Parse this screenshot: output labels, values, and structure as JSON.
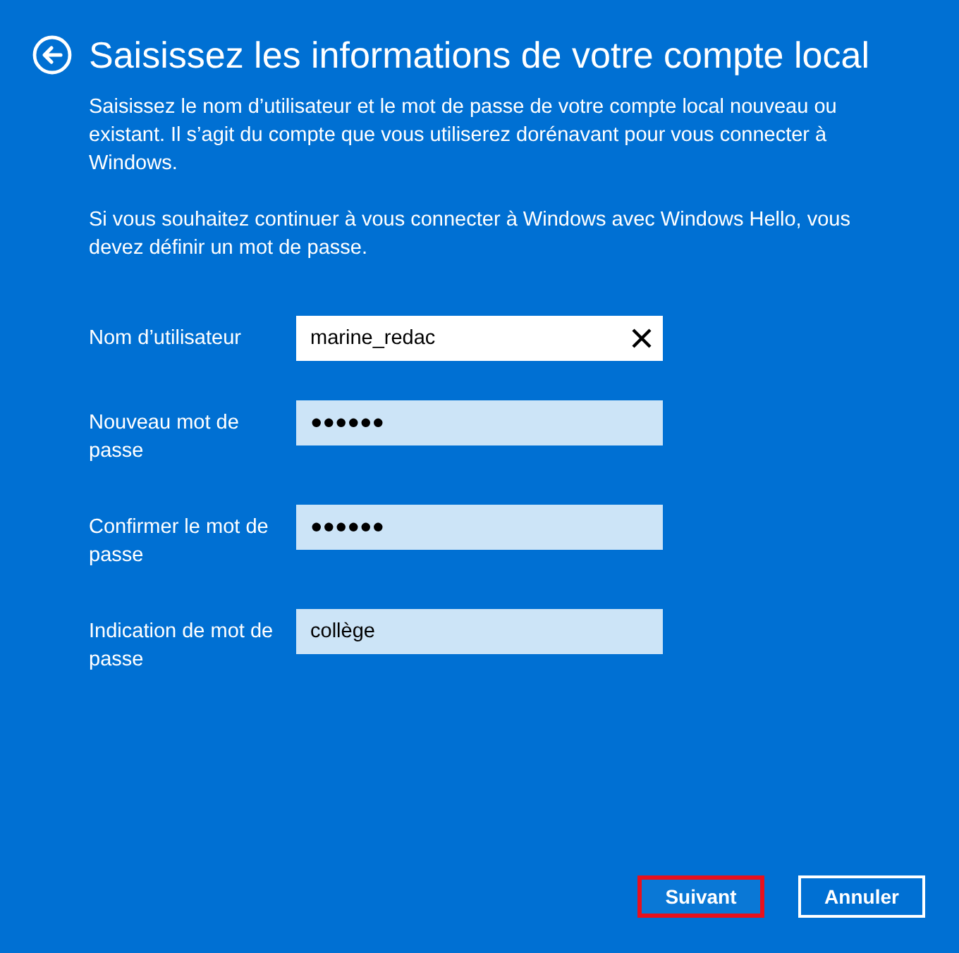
{
  "header": {
    "title": "Saisissez les informations de votre compte local"
  },
  "intro": [
    "Saisissez le nom d’utilisateur et le mot de passe de votre compte local nouveau ou existant. Il s’agit du compte que vous utiliserez dorénavant pour vous connecter à Windows.",
    "Si vous souhaitez continuer à vous connecter à Windows avec Windows Hello, vous devez définir un mot de passe."
  ],
  "fields": [
    {
      "label": "Nom d’utilisateur",
      "value": "marine_redac",
      "focused": true
    },
    {
      "label": "Nouveau mot de passe",
      "value": "●●●●●●",
      "focused": false
    },
    {
      "label": "Confirmer le mot de passe",
      "value": "●●●●●●",
      "focused": false
    },
    {
      "label": "Indication de mot de passe",
      "value": "collège",
      "focused": false
    }
  ],
  "buttons": [
    {
      "label": "Suivant",
      "highlighted": true
    },
    {
      "label": "Annuler",
      "highlighted": false
    }
  ]
}
